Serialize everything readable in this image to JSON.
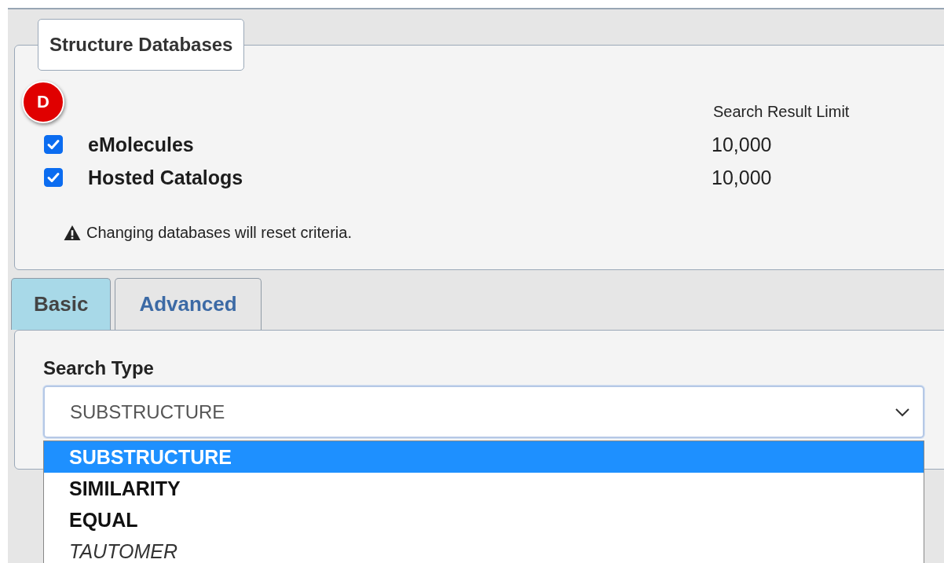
{
  "databases_panel": {
    "legend": "Structure Databases",
    "badge": "D",
    "limit_heading": "Search Result Limit",
    "databases": [
      {
        "name": "eMolecules",
        "checked": true,
        "limit": "10,000"
      },
      {
        "name": "Hosted Catalogs",
        "checked": true,
        "limit": "10,000"
      }
    ],
    "warning": "Changing databases will reset criteria."
  },
  "tabs": [
    {
      "label": "Basic",
      "selected": true
    },
    {
      "label": "Advanced",
      "selected": false
    }
  ],
  "search_type": {
    "label": "Search Type",
    "value": "SUBSTRUCTURE",
    "expanded": true,
    "options": [
      {
        "label": "SUBSTRUCTURE",
        "selected": true,
        "disabled": false
      },
      {
        "label": "SIMILARITY",
        "selected": false,
        "disabled": false
      },
      {
        "label": "EQUAL",
        "selected": false,
        "disabled": false
      },
      {
        "label": "TAUTOMER",
        "selected": false,
        "disabled": true
      }
    ]
  }
}
